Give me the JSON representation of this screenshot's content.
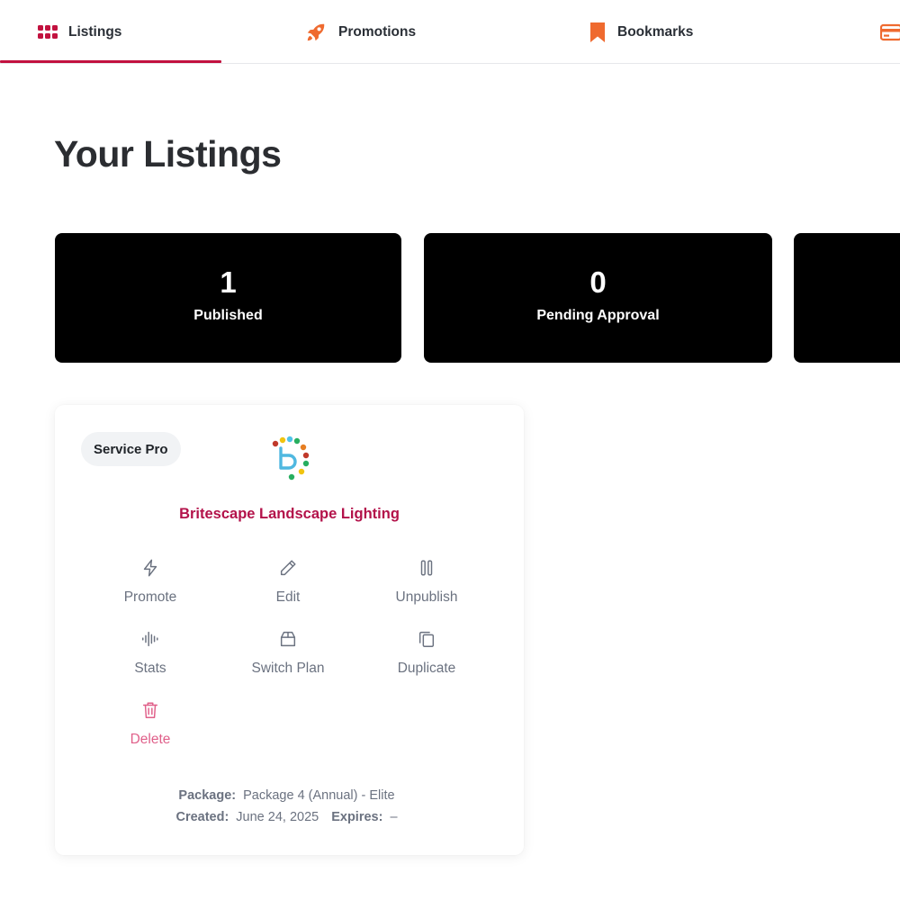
{
  "tabs": {
    "listings": "Listings",
    "promotions": "Promotions",
    "bookmarks": "Bookmarks"
  },
  "colors": {
    "accent": "#c2123f",
    "tab_icon_orange": "#ef6a2f",
    "listing_name": "#b3124a",
    "delete": "#e0608a"
  },
  "page_title": "Your Listings",
  "stats": [
    {
      "value": "1",
      "label": "Published"
    },
    {
      "value": "0",
      "label": "Pending Approval"
    }
  ],
  "listing": {
    "badge": "Service Pro",
    "name": "Britescape Landscape Lighting",
    "actions": {
      "promote": "Promote",
      "edit": "Edit",
      "unpublish": "Unpublish",
      "stats": "Stats",
      "switch_plan": "Switch Plan",
      "duplicate": "Duplicate",
      "delete": "Delete"
    },
    "meta": {
      "package_label": "Package:",
      "package_value": "Package 4 (Annual) - Elite",
      "created_label": "Created:",
      "created_value": "June 24, 2025",
      "expires_label": "Expires:",
      "expires_value": "–"
    }
  }
}
